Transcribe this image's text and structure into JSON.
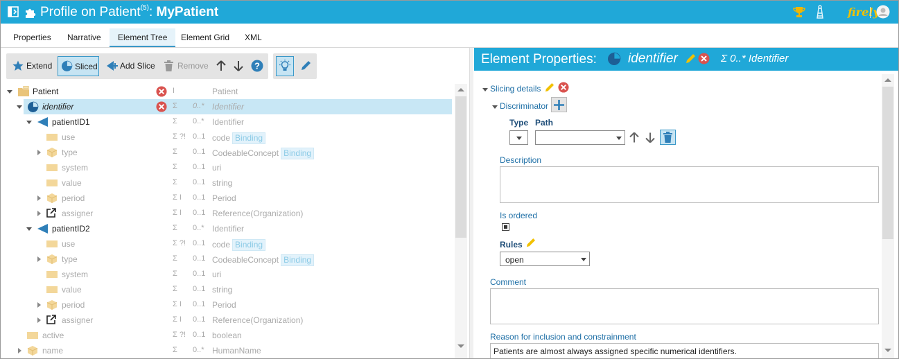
{
  "window": {
    "title_prefix": "Profile on Patient",
    "title_sup": "(5)",
    "title_separator": ":",
    "title_name": "MyPatient",
    "brand": "firely"
  },
  "tabs": [
    "Properties",
    "Narrative",
    "Element Tree",
    "Element Grid",
    "XML"
  ],
  "active_tab": "Element Tree",
  "toolbar": {
    "extend": "Extend",
    "sliced": "Sliced",
    "add_slice": "Add Slice",
    "remove": "Remove"
  },
  "tree": {
    "rows": [
      {
        "name": "Patient",
        "flags": "I",
        "card": "",
        "type": "Patient",
        "badge": ""
      },
      {
        "name": "identifier",
        "flags": "Σ",
        "card": "0..*",
        "type": "Identifier",
        "badge": ""
      },
      {
        "name": "patientID1",
        "flags": "Σ",
        "card": "0..*",
        "type": "Identifier",
        "badge": ""
      },
      {
        "name": "use",
        "flags": "Σ ?!",
        "card": "0..1",
        "type": "code",
        "badge": "Binding"
      },
      {
        "name": "type",
        "flags": "Σ",
        "card": "0..1",
        "type": "CodeableConcept",
        "badge": "Binding"
      },
      {
        "name": "system",
        "flags": "Σ",
        "card": "0..1",
        "type": "uri",
        "badge": ""
      },
      {
        "name": "value",
        "flags": "Σ",
        "card": "0..1",
        "type": "string",
        "badge": ""
      },
      {
        "name": "period",
        "flags": "Σ I",
        "card": "0..1",
        "type": "Period",
        "badge": ""
      },
      {
        "name": "assigner",
        "flags": "Σ I",
        "card": "0..1",
        "type": "Reference(Organization)",
        "badge": ""
      },
      {
        "name": "patientID2",
        "flags": "Σ",
        "card": "0..*",
        "type": "Identifier",
        "badge": ""
      },
      {
        "name": "use",
        "flags": "Σ ?!",
        "card": "0..1",
        "type": "code",
        "badge": "Binding"
      },
      {
        "name": "type",
        "flags": "Σ",
        "card": "0..1",
        "type": "CodeableConcept",
        "badge": "Binding"
      },
      {
        "name": "system",
        "flags": "Σ",
        "card": "0..1",
        "type": "uri",
        "badge": ""
      },
      {
        "name": "value",
        "flags": "Σ",
        "card": "0..1",
        "type": "string",
        "badge": ""
      },
      {
        "name": "period",
        "flags": "Σ I",
        "card": "0..1",
        "type": "Period",
        "badge": ""
      },
      {
        "name": "assigner",
        "flags": "Σ I",
        "card": "0..1",
        "type": "Reference(Organization)",
        "badge": ""
      },
      {
        "name": "active",
        "flags": "Σ ?!",
        "card": "0..1",
        "type": "boolean",
        "badge": ""
      },
      {
        "name": "name",
        "flags": "Σ",
        "card": "0..*",
        "type": "HumanName",
        "badge": ""
      }
    ]
  },
  "properties": {
    "header_label": "Element Properties:",
    "element_name": "identifier",
    "element_summary": "Σ 0..* Identifier",
    "slicing_details": "Slicing details",
    "discriminator": "Discriminator",
    "type_label": "Type",
    "path_label": "Path",
    "description_label": "Description",
    "description_value": "",
    "is_ordered_label": "Is ordered",
    "rules_label": "Rules",
    "rules_value": "open",
    "comment_label": "Comment",
    "comment_value": "",
    "reason_label": "Reason for inclusion and constrainment",
    "reason_value": "Patients are almost always assigned specific numerical identifiers."
  },
  "colors": {
    "accent": "#20a8d8",
    "selected_row": "#c8e7f5",
    "error": "#d9534f",
    "label_blue": "#1e6fa6"
  }
}
